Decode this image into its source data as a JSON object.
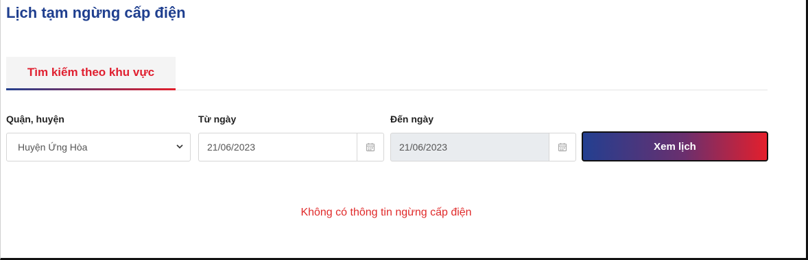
{
  "page": {
    "title": "Lịch tạm ngừng cấp điện"
  },
  "tabs": [
    {
      "label": "Tìm kiếm theo khu vực",
      "active": true
    }
  ],
  "form": {
    "district": {
      "label": "Quận, huyện",
      "value": "Huyện Ứng Hòa"
    },
    "from_date": {
      "label": "Từ ngày",
      "value": "21/06/2023"
    },
    "to_date": {
      "label": "Đến ngày",
      "value": "21/06/2023",
      "disabled": true
    },
    "submit_label": "Xem lịch"
  },
  "result": {
    "message": "Không có thông tin ngừng cấp điện"
  },
  "colors": {
    "title": "#1f3f8f",
    "accent_red": "#e02030",
    "gradient_start": "#233f90",
    "gradient_end": "#e41f2c"
  },
  "icons": {
    "select": "chevron-down-icon",
    "date": "calendar-icon"
  }
}
